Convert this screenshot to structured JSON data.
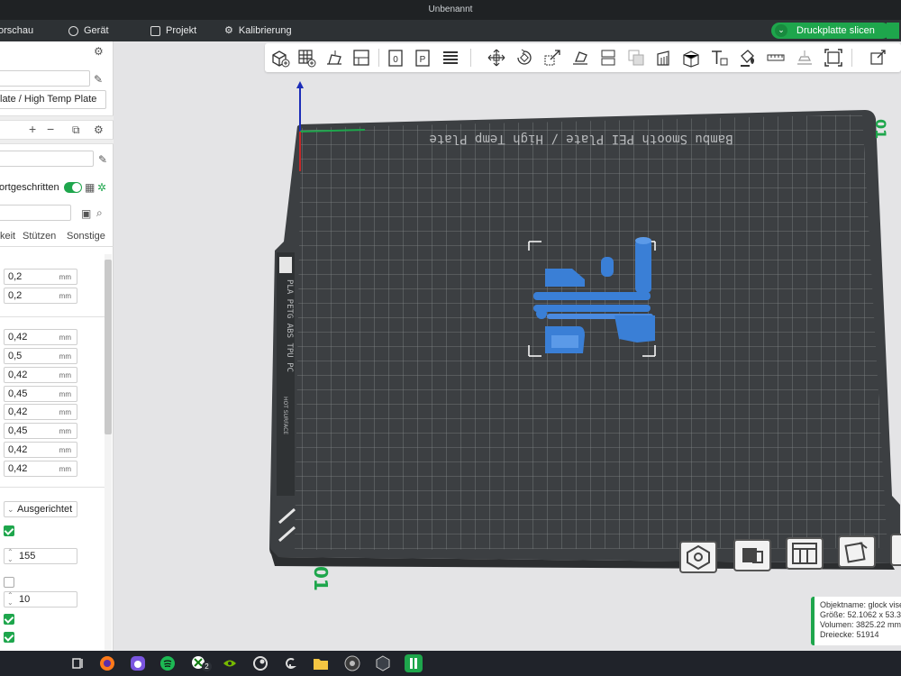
{
  "window": {
    "title": "Unbenannt"
  },
  "menu": {
    "preview": "orschau",
    "device": "Gerät",
    "project": "Projekt",
    "calibration": "Kalibrierung",
    "slice_button": "Druckplatte slicen"
  },
  "sidebar": {
    "printer_field": "",
    "plate_type": "late / High Temp Plate",
    "preset_field": "",
    "advanced_label": "ortgeschritten",
    "advanced_enabled": true,
    "search_field": "",
    "tabs": [
      "keit",
      "Stützen",
      "Sonstige"
    ],
    "layer_values": [
      {
        "value": "0,2",
        "unit": "mm"
      },
      {
        "value": "0,2",
        "unit": "mm"
      }
    ],
    "width_values": [
      {
        "value": "0,42",
        "unit": "mm"
      },
      {
        "value": "0,5",
        "unit": "mm"
      },
      {
        "value": "0,42",
        "unit": "mm"
      },
      {
        "value": "0,45",
        "unit": "mm"
      },
      {
        "value": "0,42",
        "unit": "mm"
      },
      {
        "value": "0,45",
        "unit": "mm"
      },
      {
        "value": "0,42",
        "unit": "mm"
      },
      {
        "value": "0,42",
        "unit": "mm"
      }
    ],
    "seam_select": "Ausgerichtet",
    "checkbox_1": true,
    "number_1": "155",
    "checkbox_2": false,
    "number_2": "10",
    "checkbox_3": true,
    "checkbox_4": true
  },
  "plate": {
    "label": "Bambu Smooth PEI Plate / High Temp Plate",
    "side_label": "PLA PETG ABS TPU PC",
    "warn_label": "HOT SURFACE",
    "plate_number": "01"
  },
  "object_info": {
    "name": "Objektname: glock vise",
    "size": "Größe: 52.1062 x 53.36",
    "volume": "Volumen: 3825.22 mm",
    "triangles": "Dreiecke: 51914"
  },
  "taskbar": {
    "xbox_badge": "2"
  },
  "colors": {
    "accent": "#1ea64c",
    "model": "#3a7fd6",
    "plate": "#3c3f42"
  }
}
